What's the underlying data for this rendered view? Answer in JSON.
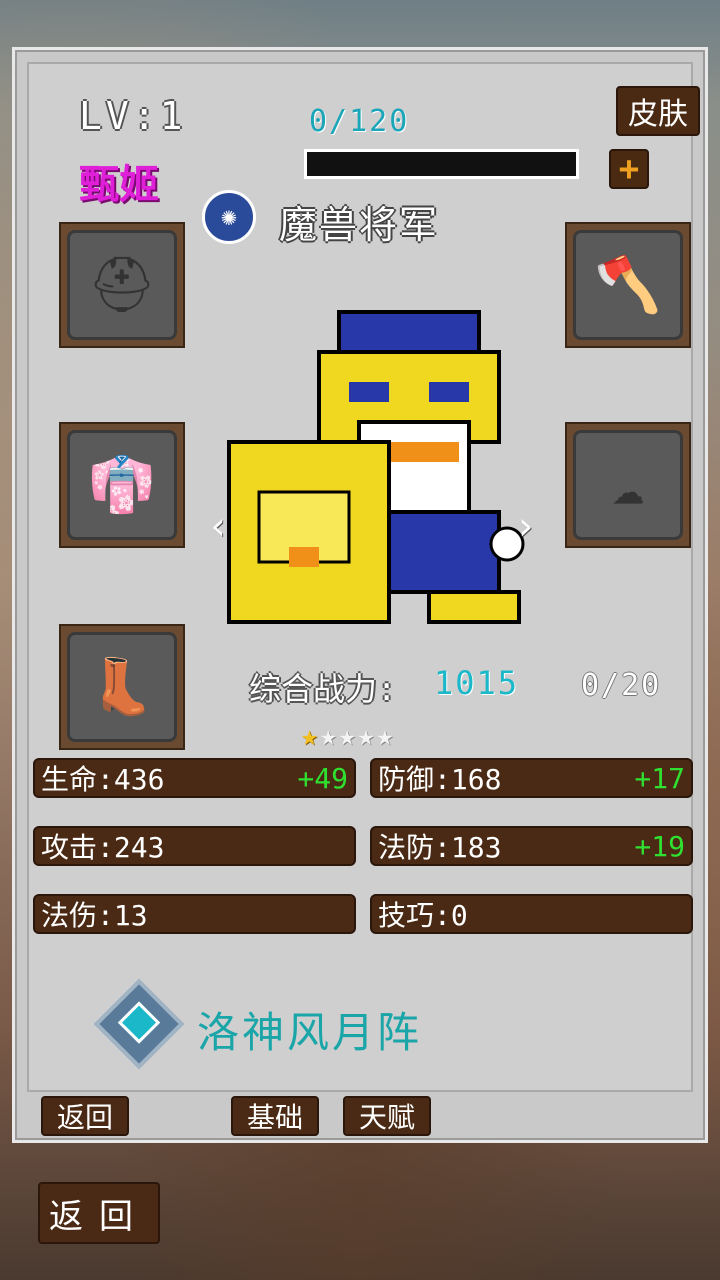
{
  "header": {
    "level": "LV:1",
    "hero_name": "甄姬",
    "exp_text": "0/120",
    "skin_button": "皮肤",
    "plus_button": "+"
  },
  "title": {
    "icon": "squid-icon",
    "text": "魔兽将军"
  },
  "equipment_slots": [
    {
      "name": "helmet",
      "icon": "helmet-icon"
    },
    {
      "name": "weapon",
      "icon": "axe-icon"
    },
    {
      "name": "armor",
      "icon": "armor-icon"
    },
    {
      "name": "accessory",
      "icon": "cloud-icon"
    },
    {
      "name": "boots",
      "icon": "boots-icon"
    }
  ],
  "combat": {
    "label": "综合战力:",
    "value": "1015",
    "fragments": "0/20",
    "stars_total": 5,
    "stars_filled": 1
  },
  "stats": [
    {
      "label": "生命:436",
      "bonus": "+49"
    },
    {
      "label": "防御:168",
      "bonus": "+17"
    },
    {
      "label": "攻击:243",
      "bonus": ""
    },
    {
      "label": "法防:183",
      "bonus": "+19"
    },
    {
      "label": "法伤:13",
      "bonus": ""
    },
    {
      "label": "技巧:0",
      "bonus": ""
    }
  ],
  "formation": {
    "icon": "formation-icon",
    "text": "洛神风月阵"
  },
  "tabs": {
    "back": "返回",
    "basic": "基础",
    "talent": "天赋"
  },
  "bottom": {
    "back": "返回"
  },
  "colors": {
    "accent": "#1aa6b8",
    "panel": "#cfcfcf",
    "button": "#4a2a14",
    "bonus": "#30e030",
    "name": "#e020d8"
  }
}
